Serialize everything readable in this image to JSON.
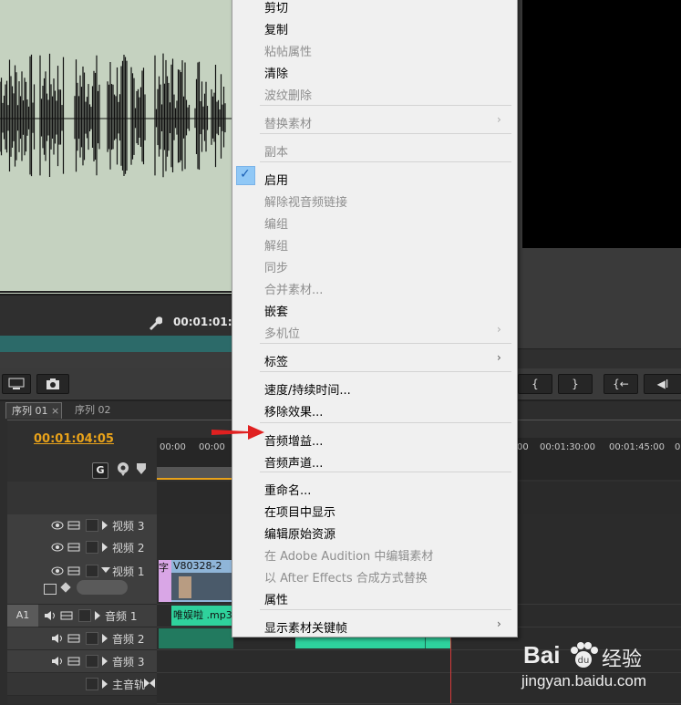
{
  "source_monitor": {
    "timecode": "00:01:01:"
  },
  "toolbar": {
    "in_point": "{",
    "out_point": "}",
    "go_to_in": "{←",
    "step_back": "◀I"
  },
  "timeline": {
    "tabs": [
      {
        "label": "序列 01",
        "close": "×"
      },
      {
        "label": "序列 02"
      }
    ],
    "playhead_time": "00:01:04:05",
    "ruler_labels": [
      "00:00",
      "00:00",
      "00",
      "00:01:30:00",
      "00:01:45:00",
      "00"
    ],
    "tracks": [
      {
        "label": "视频 3"
      },
      {
        "label": "视频 2"
      },
      {
        "label": "视频 1"
      },
      {
        "label": "音频 1",
        "target": "A1"
      },
      {
        "label": "音频 2"
      },
      {
        "label": "音频 3"
      },
      {
        "label": "主音轨"
      }
    ],
    "clips": {
      "title_clip": "字",
      "video_clip": "V80328-2",
      "video_clip_2": "V",
      "audio_clip": "唯娱啦 .mp3"
    }
  },
  "context_menu": {
    "items": [
      {
        "label": "剪切",
        "enabled": true
      },
      {
        "label": "复制",
        "enabled": true
      },
      {
        "label": "粘帖属性",
        "enabled": false
      },
      {
        "label": "清除",
        "enabled": true
      },
      {
        "label": "波纹删除",
        "enabled": false
      },
      {
        "label": "替换素材",
        "enabled": false,
        "submenu": true
      },
      {
        "label": "副本",
        "enabled": false
      },
      {
        "label": "启用",
        "enabled": true,
        "checked": true
      },
      {
        "label": "解除视音频链接",
        "enabled": false
      },
      {
        "label": "编组",
        "enabled": false
      },
      {
        "label": "解组",
        "enabled": false
      },
      {
        "label": "同步",
        "enabled": false
      },
      {
        "label": "合并素材...",
        "enabled": false
      },
      {
        "label": "嵌套",
        "enabled": true
      },
      {
        "label": "多机位",
        "enabled": false,
        "submenu": true
      },
      {
        "label": "标签",
        "enabled": true,
        "submenu": true
      },
      {
        "label": "速度/持续时间...",
        "enabled": true
      },
      {
        "label": "移除效果...",
        "enabled": true
      },
      {
        "label": "音频增益...",
        "enabled": true
      },
      {
        "label": "音频声道...",
        "enabled": true
      },
      {
        "label": "重命名...",
        "enabled": true
      },
      {
        "label": "在项目中显示",
        "enabled": true
      },
      {
        "label": "编辑原始资源",
        "enabled": true
      },
      {
        "label": "在 Adobe Audition 中编辑素材",
        "enabled": false
      },
      {
        "label": "以 After Effects 合成方式替换",
        "enabled": false
      },
      {
        "label": "属性",
        "enabled": true
      },
      {
        "label": "显示素材关键帧",
        "enabled": true,
        "submenu": true
      }
    ],
    "submenu_glyph": "›",
    "check_glyph": "✓"
  },
  "annotation": {
    "arrow_color": "#e02020"
  },
  "watermark": {
    "brand": "Bai",
    "brand_suffix": "经验",
    "url": "jingyan.baidu.com"
  }
}
